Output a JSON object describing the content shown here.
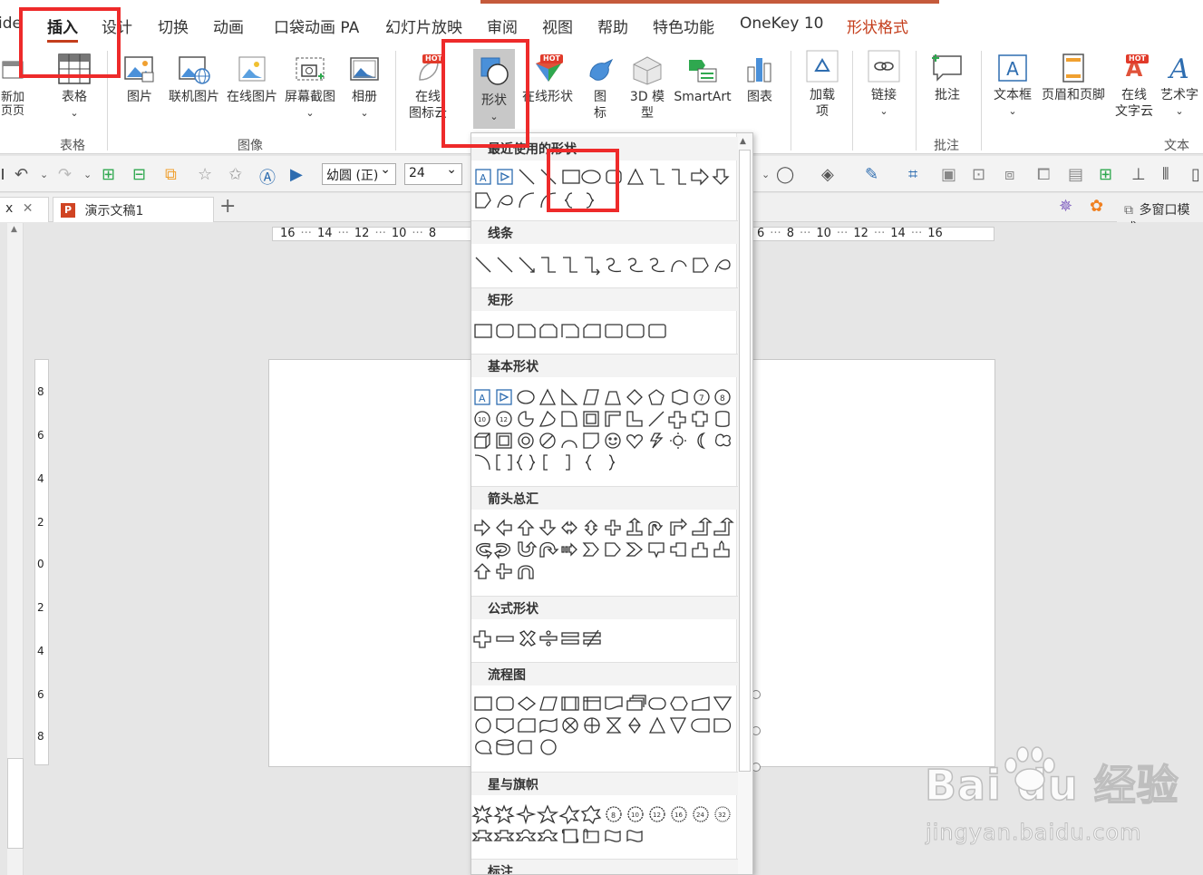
{
  "tabs": [
    "ide",
    "插入",
    "设计",
    "切换",
    "动画",
    "口袋动画 PA",
    "幻灯片放映",
    "审阅",
    "视图",
    "帮助",
    "特色功能",
    "OneKey 10",
    "形状格式"
  ],
  "ribbon": {
    "add_page": "新加\n页页",
    "table": "表格",
    "picture": "图片",
    "online_picture": "联机图片",
    "online_picture2": "在线图片",
    "screenshot": "屏幕截图",
    "album": "相册",
    "online_icons": "在线\n图标云",
    "shapes": "形状",
    "online_shapes": "在线形状",
    "icons": "图\n标",
    "model3d": "3D 模\n型",
    "smartart": "SmartArt",
    "chart": "图表",
    "addins": "加载\n项",
    "link": "链接",
    "comment": "批注",
    "textbox": "文本框",
    "header_footer": "页眉和页脚",
    "online_text": "在线\n文字云",
    "wordart": "艺术字",
    "hot": "HOT",
    "groups": {
      "table": "表格",
      "image": "图像",
      "comment": "批注",
      "text": "文本"
    }
  },
  "qat": {
    "font": "幼圆 (正)",
    "size": "24"
  },
  "doctabs": {
    "prev": "x",
    "doc1": "演示文稿1",
    "multiwin": "多窗口模式"
  },
  "ruler": {
    "h_left": [
      "16",
      "14",
      "12",
      "10",
      "8"
    ],
    "h_right": [
      "6",
      "8",
      "10",
      "12",
      "14",
      "16"
    ],
    "v": [
      "8",
      "6",
      "4",
      "2",
      "0",
      "2",
      "4",
      "6",
      "8"
    ]
  },
  "shapes_menu": {
    "recent": "最近使用的形状",
    "lines": "线条",
    "rect": "矩形",
    "basic": "基本形状",
    "arrows": "箭头总汇",
    "equation": "公式形状",
    "flowchart": "流程图",
    "stars": "星与旗帜",
    "callouts": "标注"
  },
  "watermark": {
    "brand": "Bai du 经验",
    "url": "jingyan.baidu.com"
  }
}
